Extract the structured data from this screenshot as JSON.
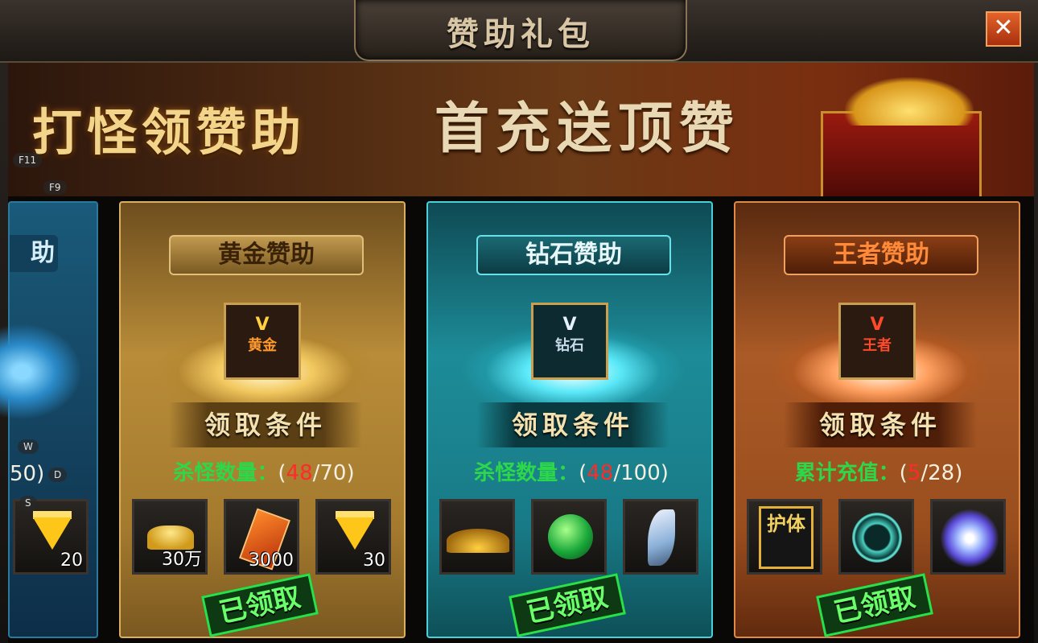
{
  "window": {
    "title": "赞助礼包",
    "close_label": "✕"
  },
  "banner": {
    "left_slogan": "打怪领赞助",
    "right_slogan": "首充送顶赞"
  },
  "hotkeys": {
    "f11": "F11",
    "f9": "F9",
    "w": "W",
    "d": "D",
    "s": "S"
  },
  "partial_card": {
    "name_fragment": "助",
    "progress_fragment": "50)",
    "item_qty": "20"
  },
  "cards": [
    {
      "name": "黄金赞助",
      "badge_v": "V",
      "badge_text": "黄金",
      "condition_title": "领取条件",
      "progress_label": "杀怪数量：",
      "progress_open": "(",
      "progress_current": "48",
      "progress_rest": "/70)",
      "items": [
        {
          "icon": "gold-ingot-icon",
          "qty": "30万"
        },
        {
          "icon": "scroll-icon",
          "qty": "3000"
        },
        {
          "icon": "diamond-icon",
          "qty": "30"
        }
      ],
      "status": "已领取"
    },
    {
      "name": "钻石赞助",
      "badge_v": "V",
      "badge_text": "钻石",
      "condition_title": "领取条件",
      "progress_label": "杀怪数量：",
      "progress_open": "(",
      "progress_current": "48",
      "progress_rest": "/100)",
      "items": [
        {
          "icon": "golden-hat-icon",
          "qty": ""
        },
        {
          "icon": "jade-orb-icon",
          "qty": ""
        },
        {
          "icon": "blade-icon",
          "qty": ""
        }
      ],
      "status": "已领取"
    },
    {
      "name": "王者赞助",
      "badge_v": "V",
      "badge_text": "王者",
      "condition_title": "领取条件",
      "progress_label": "累计充值：",
      "progress_open": "(",
      "progress_current": "5",
      "progress_rest": "/28)",
      "items": [
        {
          "icon": "protection-book-icon",
          "qty": "",
          "label": "护体"
        },
        {
          "icon": "jade-ring-icon",
          "qty": ""
        },
        {
          "icon": "lotus-orb-icon",
          "qty": ""
        }
      ],
      "status": "已领取"
    }
  ],
  "colors": {
    "gold_card": "#b58a32",
    "diamond_card": "#1d7f8c",
    "king_card": "#a9521f",
    "progress_green": "#2cd84a",
    "progress_red": "#ff2a2a",
    "claimed_green": "#2ae04a"
  }
}
